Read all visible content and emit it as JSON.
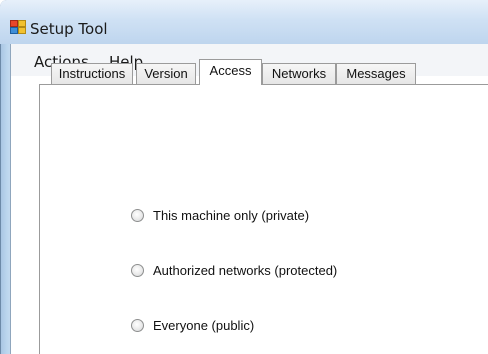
{
  "window": {
    "title": "Setup Tool"
  },
  "menu": {
    "items": [
      {
        "label": "Actions"
      },
      {
        "label": "Help"
      }
    ]
  },
  "tabs": [
    {
      "label": "Instructions",
      "active": false
    },
    {
      "label": "Version",
      "active": false
    },
    {
      "label": "Access",
      "active": true
    },
    {
      "label": "Networks",
      "active": false
    },
    {
      "label": "Messages",
      "active": false
    }
  ],
  "access": {
    "options": [
      {
        "label": "This machine only (private)",
        "selected": false
      },
      {
        "label": "Authorized networks (protected)",
        "selected": false
      },
      {
        "label": "Everyone (public)",
        "selected": false
      }
    ]
  },
  "icons": {
    "app_icon": "setup-app-icon",
    "radio": "radio-button"
  },
  "colors": {
    "title_bar": "#cfe1f4",
    "menu_bar": "#f3f5f8",
    "tab_border": "#9b9b9b"
  }
}
